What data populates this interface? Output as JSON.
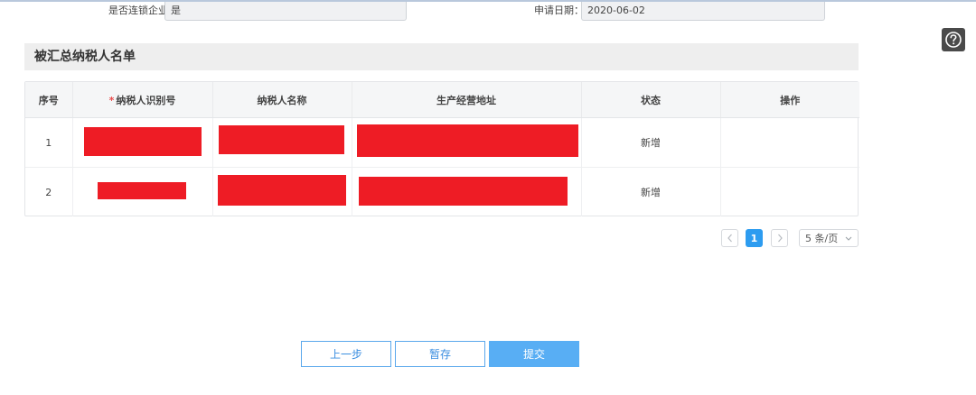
{
  "form": {
    "chain_label": "是否连锁企业：",
    "chain_value": "是",
    "date_label": "申请日期：",
    "date_value": "2020-06-02"
  },
  "help": {
    "icon": "help-circle-icon"
  },
  "section": {
    "title": "被汇总纳税人名单"
  },
  "table": {
    "columns": {
      "seq": "序号",
      "required_mark": "*",
      "tax_id": "纳税人识别号",
      "name": "纳税人名称",
      "address": "生产经营地址",
      "status": "状态",
      "action": "操作"
    },
    "rows": [
      {
        "seq": "1",
        "status": "新增"
      },
      {
        "seq": "2",
        "status": "新增"
      }
    ],
    "redaction_color": "#ee1c25"
  },
  "pagination": {
    "prev_icon": "chevron-left-icon",
    "current_page": "1",
    "next_icon": "chevron-right-icon",
    "page_size": "5 条/页",
    "dropdown_icon": "chevron-down-icon"
  },
  "actions": {
    "prev_label": "上一步",
    "save_label": "暂存",
    "submit_label": "提交"
  },
  "colors": {
    "accent": "#2d9cf0",
    "primary_button": "#58aef4",
    "section_bg": "#eeeeee"
  }
}
